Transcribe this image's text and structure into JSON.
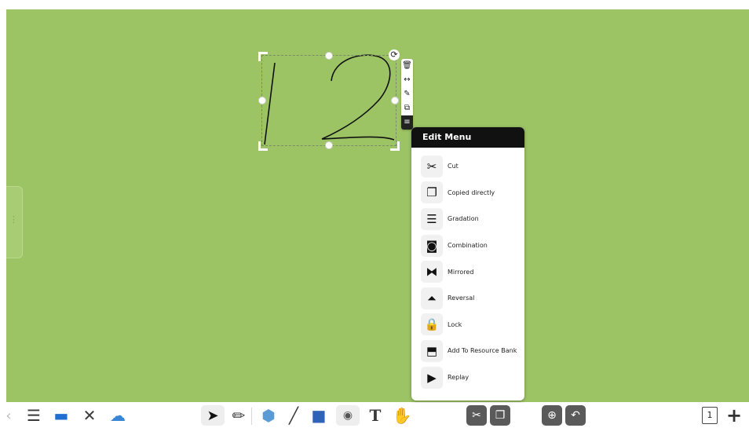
{
  "canvas": {
    "background": "#9cc465"
  },
  "mini_toolbar": {
    "rotate_icon": "rotate-icon",
    "items": [
      {
        "name": "delete-icon",
        "glyph": "🗑"
      },
      {
        "name": "line-style-icon",
        "glyph": "↔"
      },
      {
        "name": "pen-color-icon",
        "glyph": "✎"
      },
      {
        "name": "copy-icon",
        "glyph": "⧉"
      },
      {
        "name": "edit-menu-icon",
        "glyph": "≡"
      }
    ]
  },
  "edit_menu": {
    "title": "Edit Menu",
    "items": [
      {
        "label": "Cut",
        "icon": "scissors-icon",
        "glyph": "✂"
      },
      {
        "label": "Copied directly",
        "icon": "copy-icon",
        "glyph": "❐"
      },
      {
        "label": "Gradation",
        "icon": "layer-order-icon",
        "glyph": "☰"
      },
      {
        "label": "Combination",
        "icon": "combine-icon",
        "glyph": "◙"
      },
      {
        "label": "Mirrored",
        "icon": "mirror-icon",
        "glyph": "⧓"
      },
      {
        "label": "Reversal",
        "icon": "flip-icon",
        "glyph": "⏶"
      },
      {
        "label": "Lock",
        "icon": "lock-icon",
        "glyph": "🔒"
      },
      {
        "label": "Add To Resource Bank",
        "icon": "resource-bank-icon",
        "glyph": "⬒"
      },
      {
        "label": "Replay",
        "icon": "replay-icon",
        "glyph": "▶"
      }
    ]
  },
  "bottom_toolbar": {
    "left": [
      "menu-icon",
      "display-icon",
      "tools-icon",
      "cloud-icon"
    ],
    "draw": [
      "select-arrow-icon",
      "pencil-icon",
      "eraser-icon",
      "line-icon",
      "rectangle-icon",
      "fill-icon",
      "text-icon",
      "hand-icon"
    ],
    "edit": [
      "cut-icon",
      "copy-icon"
    ],
    "nav": [
      "target-icon",
      "undo-icon"
    ],
    "page_number": "1",
    "add_page_icon": "plus-icon"
  }
}
